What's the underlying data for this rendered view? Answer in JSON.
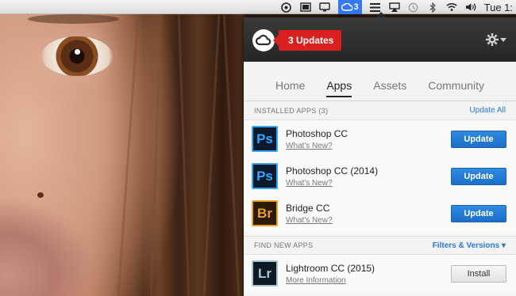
{
  "menubar": {
    "cc_count": "3",
    "clock": "Tue 1:"
  },
  "panel": {
    "badge": "3 Updates",
    "tabs": [
      {
        "label": "Home"
      },
      {
        "label": "Apps"
      },
      {
        "label": "Assets"
      },
      {
        "label": "Community"
      }
    ],
    "active_tab": "Apps",
    "installed": {
      "heading": "INSTALLED APPS (3)",
      "action": "Update All",
      "apps": [
        {
          "icon": "Ps",
          "name": "Photoshop CC",
          "link": "What's New?",
          "button": "Update"
        },
        {
          "icon": "Ps",
          "name": "Photoshop CC (2014)",
          "link": "What's New?",
          "button": "Update"
        },
        {
          "icon": "Br",
          "name": "Bridge CC",
          "link": "What's New?",
          "button": "Update"
        }
      ]
    },
    "find": {
      "heading": "FIND NEW APPS",
      "action": "Filters & Versions",
      "apps": [
        {
          "icon": "Lr",
          "name": "Lightroom CC (2015)",
          "link": "More Information",
          "button": "Install"
        }
      ]
    }
  },
  "colors": {
    "accent": "#1c6fc9",
    "badge": "#d9201f",
    "photoshop": "#30a8ff",
    "bridge": "#e7a026",
    "lightroom": "#a6c4d6"
  }
}
